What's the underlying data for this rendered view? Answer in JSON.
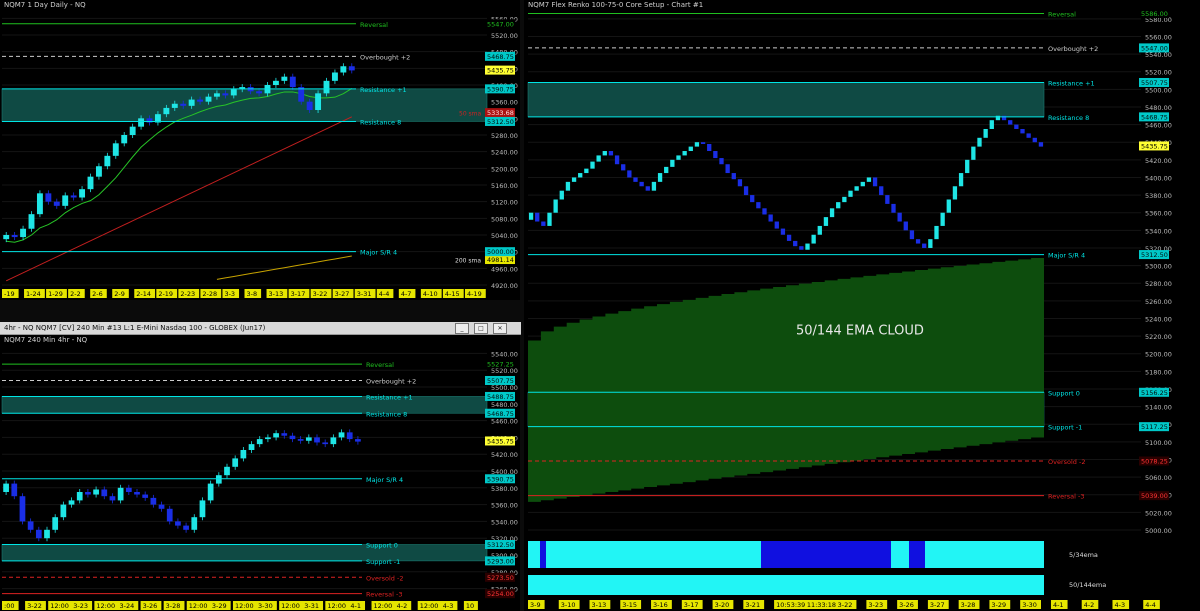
{
  "panels": {
    "daily": {
      "title": "NQM7 1 Day  Daily - NQ",
      "price_labels": [
        "5560.00",
        "5520.00",
        "5480.00",
        "5440.00",
        "5400.00",
        "5360.00",
        "5320.00",
        "5280.00",
        "5240.00",
        "5200.00",
        "5160.00",
        "5120.00",
        "5080.00",
        "5040.00",
        "5000.00",
        "4960.00",
        "4920.00"
      ],
      "date_labels": [
        "-19",
        "1-24",
        "1-29",
        "2-2",
        "2-6",
        "2-9",
        "2-14",
        "2-19",
        "2-23",
        "2-28",
        "3-3",
        "3-8",
        "3-13",
        "3-17",
        "3-22",
        "3-27",
        "3-31",
        "4-4",
        "4-7",
        "4-10",
        "4-15",
        "4-19"
      ],
      "levels": [
        {
          "name": "Reversal",
          "value": "5547.00",
          "color": "#1fbf1f"
        },
        {
          "name": "Overbought +2",
          "value": "5468.75",
          "color": "#cccccc"
        },
        {
          "name": "Resistance +1",
          "value": "5390.75",
          "color": "#00e5e5"
        },
        {
          "name": "Resistance 8",
          "value": "5312.50",
          "color": "#00e5e5"
        },
        {
          "name": "Major S/R 4",
          "value": "5000.00",
          "color": "#00e5e5"
        }
      ],
      "ma_labels": [
        {
          "name": "50 sma",
          "value": "5333.68",
          "color": "#cc2222"
        },
        {
          "name": "200 sma",
          "value": "4981.14",
          "color": "#c8a400"
        }
      ],
      "last_price": "5435.75"
    },
    "h4": {
      "window_title": "4hr - NQ  NQM7 [CV]  240 Min  #13  L:1  E-Mini Nasdaq 100 - GLOBEX (Jun17)",
      "title": "NQM7 240 Min  4hr - NQ",
      "price_labels": [
        "5540.00",
        "5520.00",
        "5500.00",
        "5480.00",
        "5460.00",
        "5440.00",
        "5420.00",
        "5400.00",
        "5380.00",
        "5360.00",
        "5340.00",
        "5320.00",
        "5300.00",
        "5280.00",
        "5260.00"
      ],
      "date_labels": [
        ":00",
        "3-22",
        "12:00",
        "3-23",
        "12:00",
        "3-24",
        "3-26",
        "3-28",
        "12:00",
        "3-29",
        "12:00",
        "3-30",
        "12:00",
        "3-31",
        "12:00",
        "4-1",
        "12:00",
        "4-2",
        "12:00",
        "4-3",
        "10"
      ],
      "levels": [
        {
          "name": "Reversal",
          "value": "5527.25",
          "color": "#1fbf1f"
        },
        {
          "name": "Overbought +2",
          "value": "5507.75",
          "color": "#cccccc"
        },
        {
          "name": "Resistance +1",
          "value": "5488.75",
          "color": "#00e5e5"
        },
        {
          "name": "Resistance 8",
          "value": "5468.75",
          "color": "#00e5e5"
        },
        {
          "name": "Major S/R 4",
          "value": "5390.75",
          "color": "#00e5e5"
        },
        {
          "name": "Support 0",
          "value": "5312.50",
          "color": "#00e5e5"
        },
        {
          "name": "Support -1",
          "value": "5293.00",
          "color": "#00e5e5"
        },
        {
          "name": "Oversold -2",
          "value": "5273.50",
          "color": "#dd2222"
        },
        {
          "name": "Reversal -3",
          "value": "5254.00",
          "color": "#dd2222"
        }
      ],
      "last_price": "5435.75"
    },
    "renko": {
      "title": "NQM7 Flex Renko 100-75-0 Core Setup - Chart #1",
      "cloud_label": "50/144 EMA CLOUD",
      "price_labels": [
        "5580.00",
        "5560.00",
        "5540.00",
        "5520.00",
        "5500.00",
        "5480.00",
        "5460.00",
        "5440.00",
        "5420.00",
        "5400.00",
        "5380.00",
        "5360.00",
        "5340.00",
        "5320.00",
        "5300.00",
        "5280.00",
        "5260.00",
        "5240.00",
        "5220.00",
        "5200.00",
        "5180.00",
        "5160.00",
        "5140.00",
        "5120.00",
        "5100.00",
        "5080.00",
        "5060.00",
        "5040.00",
        "5020.00",
        "5000.00"
      ],
      "date_labels": [
        "3-9",
        "3-10",
        "3-13",
        "3-15",
        "3-16",
        "3-17",
        "3-20",
        "3-21",
        "10:53:39",
        "11:33:18",
        "3-22",
        "3-23",
        "3-26",
        "3-27",
        "3-28",
        "3-29",
        "3-30",
        "4-1",
        "4-2",
        "4-3",
        "4-4"
      ],
      "levels": [
        {
          "name": "Reversal",
          "value": "5586.00",
          "color": "#1fbf1f"
        },
        {
          "name": "Overbought +2",
          "value": "5547.00",
          "color": "#cccccc"
        },
        {
          "name": "Resistance +1",
          "value": "5507.75",
          "color": "#00e5e5"
        },
        {
          "name": "Resistance 8",
          "value": "5468.75",
          "color": "#00e5e5"
        },
        {
          "name": "Major S/R 4",
          "value": "5312.50",
          "color": "#00e5e5"
        },
        {
          "name": "Support 0",
          "value": "5156.25",
          "color": "#00e5e5"
        },
        {
          "name": "Support -1",
          "value": "5117.25",
          "color": "#00e5e5"
        },
        {
          "name": "Oversold -2",
          "value": "5078.25",
          "color": "#dd2222"
        },
        {
          "name": "Reversal -3",
          "value": "5039.00",
          "color": "#dd2222"
        }
      ],
      "last_price": "5435.75",
      "ema_strip_labels": [
        "5/34ema",
        "50/144ema"
      ]
    }
  },
  "colors": {
    "up": "#1fe6e6",
    "down": "#1a2ee6",
    "cyan_zone": "#0f4a44",
    "green_cloud": "#0d4d0d"
  },
  "chart_data": [
    {
      "type": "candlestick",
      "name": "daily",
      "ylim": [
        4920,
        5580
      ],
      "levels": [
        5547.0,
        5468.75,
        5390.75,
        5312.5,
        5000.0
      ],
      "last": 5435.75,
      "closes": [
        5040,
        5035,
        5055,
        5090,
        5140,
        5120,
        5110,
        5135,
        5130,
        5150,
        5180,
        5205,
        5230,
        5260,
        5280,
        5300,
        5320,
        5310,
        5330,
        5345,
        5355,
        5350,
        5365,
        5360,
        5372,
        5380,
        5375,
        5390,
        5395,
        5385,
        5380,
        5400,
        5410,
        5420,
        5395,
        5360,
        5340,
        5380,
        5410,
        5430,
        5445,
        5435
      ]
    },
    {
      "type": "candlestick",
      "name": "h4",
      "ylim": [
        5250,
        5550
      ],
      "levels": [
        5527.25,
        5507.75,
        5488.75,
        5468.75,
        5390.75,
        5312.5,
        5293.0,
        5273.5,
        5254.0
      ],
      "last": 5435.75,
      "closes": [
        5385,
        5370,
        5340,
        5330,
        5320,
        5330,
        5345,
        5360,
        5365,
        5375,
        5372,
        5378,
        5370,
        5365,
        5380,
        5375,
        5372,
        5368,
        5360,
        5355,
        5340,
        5335,
        5330,
        5345,
        5365,
        5385,
        5395,
        5405,
        5415,
        5425,
        5432,
        5438,
        5440,
        5445,
        5442,
        5438,
        5436,
        5440,
        5434,
        5432,
        5440,
        5446,
        5438,
        5435
      ]
    },
    {
      "type": "renko",
      "name": "renko",
      "ylim": [
        5000,
        5590
      ],
      "levels": [
        5586.0,
        5547.0,
        5507.75,
        5468.75,
        5312.5,
        5156.25,
        5117.25,
        5078.25,
        5039.0
      ],
      "last": 5435.75,
      "closes": [
        5360,
        5350,
        5345,
        5360,
        5375,
        5385,
        5395,
        5400,
        5405,
        5410,
        5418,
        5425,
        5430,
        5425,
        5415,
        5408,
        5400,
        5395,
        5390,
        5385,
        5395,
        5405,
        5412,
        5420,
        5425,
        5430,
        5435,
        5440,
        5438,
        5430,
        5422,
        5415,
        5405,
        5398,
        5390,
        5380,
        5372,
        5365,
        5358,
        5350,
        5342,
        5335,
        5328,
        5322,
        5318,
        5325,
        5335,
        5345,
        5355,
        5365,
        5372,
        5378,
        5385,
        5390,
        5395,
        5400,
        5390,
        5380,
        5370,
        5360,
        5350,
        5340,
        5330,
        5325,
        5320,
        5330,
        5345,
        5360,
        5375,
        5390,
        5405,
        5420,
        5435,
        5445,
        5455,
        5465,
        5470,
        5465,
        5460,
        5455,
        5450,
        5445,
        5440,
        5435
      ]
    }
  ]
}
